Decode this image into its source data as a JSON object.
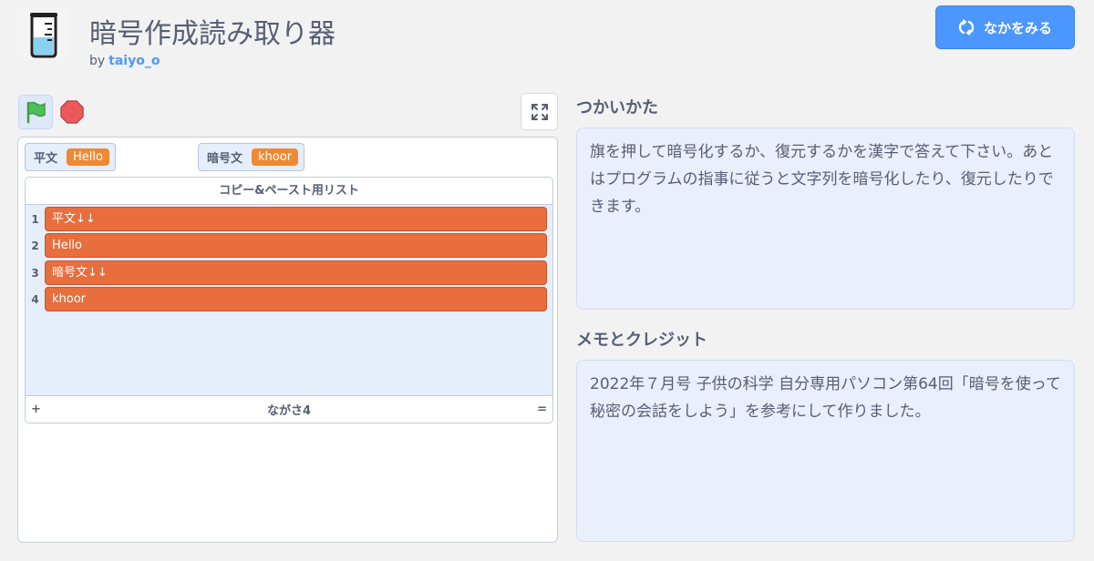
{
  "project": {
    "title": "暗号作成読み取り器",
    "by_label": "by",
    "author": "taiyo_o",
    "see_inside_label": "なかをみる"
  },
  "controls": {
    "green_flag_icon": "green-flag-icon",
    "stop_icon": "stop-sign-icon",
    "fullscreen_icon": "fullscreen-icon"
  },
  "stage": {
    "monitors": [
      {
        "label": "平文",
        "value": "Hello"
      },
      {
        "label": "暗号文",
        "value": "khoor"
      }
    ],
    "list": {
      "title": "コピー&ペースト用リスト",
      "items": [
        {
          "index": "1",
          "value": "平文↓↓"
        },
        {
          "index": "2",
          "value": "Hello"
        },
        {
          "index": "3",
          "value": "暗号文↓↓"
        },
        {
          "index": "4",
          "value": "khoor"
        }
      ],
      "add_label": "+",
      "length_label": "ながさ4",
      "resize_label": "="
    }
  },
  "instructions": {
    "heading": "つかいかた",
    "text": "旗を押して暗号化するか、復元するかを漢字で答えて下さい。あとはプログラムの指事に従うと文字列を暗号化したり、復元したりできます。"
  },
  "notes": {
    "heading": "メモとクレジット",
    "text": "2022年７月号 子供の科学 自分専用パソコン第64回「暗号を使って秘密の会話をしよう」を参考にして作りました。"
  },
  "colors": {
    "accent": "#4c97ff",
    "list_item": "#e86e3e",
    "monitor_value": "#f08a32",
    "panel": "#e9effb"
  }
}
